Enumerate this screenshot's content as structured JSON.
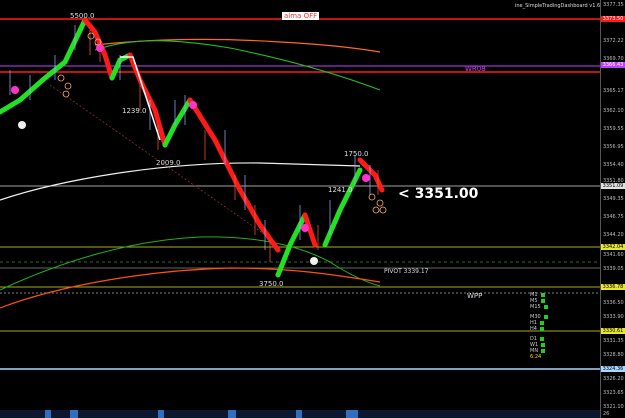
{
  "dashboard_title": "ine_SimpleTradingDashboard v1.6",
  "indicators": {
    "alma_label": "alma OFF",
    "wr08_label": "WR08",
    "pivot_label": "PIVOT 3339.17",
    "wpp_label": "WPP",
    "current_price": "<  3351.00",
    "countdown": "6:24"
  },
  "volume_labels": [
    "5500.0",
    "1239.0",
    "2009.0",
    "3750.0",
    "1750.0",
    "1241.0"
  ],
  "timeframes": [
    "M1",
    "M5",
    "M15",
    "M30",
    "H1",
    "H4",
    "D1",
    "W1",
    "MN"
  ],
  "price_axis": {
    "ticks": [
      "3377.35",
      "3372.22",
      "3369.70",
      "3365.17",
      "3362.10",
      "3359.55",
      "3356.95",
      "3354.40",
      "3351.80",
      "3349.35",
      "3346.75",
      "3344.20",
      "3341.60",
      "3339.05",
      "3336.50",
      "3333.90",
      "3331.35",
      "3328.80",
      "3326.20",
      "3323.65",
      "3321.10"
    ],
    "tags": [
      {
        "text": "3373.50",
        "bg": "#ff1a1a"
      },
      {
        "text": "3366.43",
        "bg": "#c040ff"
      },
      {
        "text": "3351.09",
        "bg": "#e0e0e0"
      },
      {
        "text": "3342.04",
        "bg": "#e6e633"
      },
      {
        "text": "3336.78",
        "bg": "#e6e633"
      },
      {
        "text": "3330.61",
        "bg": "#e6e633"
      },
      {
        "text": "3324.36",
        "bg": "#a8d8ff"
      }
    ],
    "last": "26"
  },
  "colors": {
    "up": "#22e022",
    "down": "#ff1a1a",
    "bg": "#000000",
    "pivot": "#e6e633"
  }
}
